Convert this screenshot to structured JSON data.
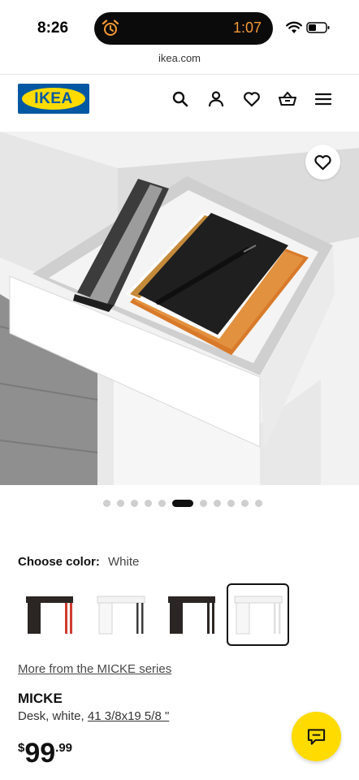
{
  "status_bar": {
    "time": "8:26",
    "timer": "1:07",
    "icons": [
      "alarm-icon",
      "wifi-icon",
      "battery-icon"
    ],
    "timer_color": "#f39a37"
  },
  "browser": {
    "url": "ikea.com"
  },
  "header": {
    "logo_text": "IKEA",
    "brand_colors": {
      "blue": "#0058a3",
      "yellow": "#ffdb00"
    },
    "icons": [
      "search-icon",
      "account-icon",
      "favorites-icon",
      "cart-icon",
      "menu-icon"
    ]
  },
  "gallery": {
    "total_images": 11,
    "active_index": 5,
    "favorite_icon": "heart-icon"
  },
  "color_selector": {
    "label": "Choose color:",
    "selected": "White",
    "swatch_count": 4,
    "selected_index": 3
  },
  "product": {
    "series_link": "More from the MICKE series",
    "name": "MICKE",
    "description": "Desk, white,",
    "dimensions": "41 3/8x19 5/8 \"",
    "price_currency": "$",
    "price_whole": "99",
    "price_decimal": ".99"
  },
  "chat": {
    "icon": "chat-icon",
    "color": "#ffdb00"
  }
}
